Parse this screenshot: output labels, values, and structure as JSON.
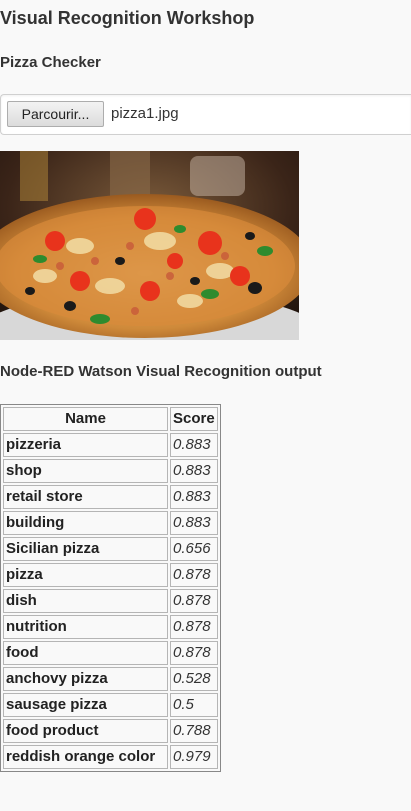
{
  "page": {
    "title": "Visual Recognition Workshop",
    "section_title": "Pizza Checker",
    "output_title": "Node-RED Watson Visual Recognition output"
  },
  "file_input": {
    "button_label": "Parcourir...",
    "file_name": "pizza1.jpg"
  },
  "image": {
    "icon": "pizza-photo",
    "description_colors": {
      "crust": "#c9852f",
      "sauce": "#c0392b",
      "cheese": "#f1d9a0",
      "tomato": "#e8331c",
      "olive": "#1a1a1a",
      "basil": "#2e8b2e",
      "background": "#3a2418"
    }
  },
  "table": {
    "headers": {
      "name": "Name",
      "score": "Score"
    },
    "rows": [
      {
        "name": "pizzeria",
        "score": "0.883"
      },
      {
        "name": "shop",
        "score": "0.883"
      },
      {
        "name": "retail store",
        "score": "0.883"
      },
      {
        "name": "building",
        "score": "0.883"
      },
      {
        "name": "Sicilian pizza",
        "score": "0.656"
      },
      {
        "name": "pizza",
        "score": "0.878"
      },
      {
        "name": "dish",
        "score": "0.878"
      },
      {
        "name": "nutrition",
        "score": "0.878"
      },
      {
        "name": "food",
        "score": "0.878"
      },
      {
        "name": "anchovy pizza",
        "score": "0.528"
      },
      {
        "name": "sausage pizza",
        "score": "0.5"
      },
      {
        "name": "food product",
        "score": "0.788"
      },
      {
        "name": "reddish orange color",
        "score": "0.979"
      }
    ]
  }
}
